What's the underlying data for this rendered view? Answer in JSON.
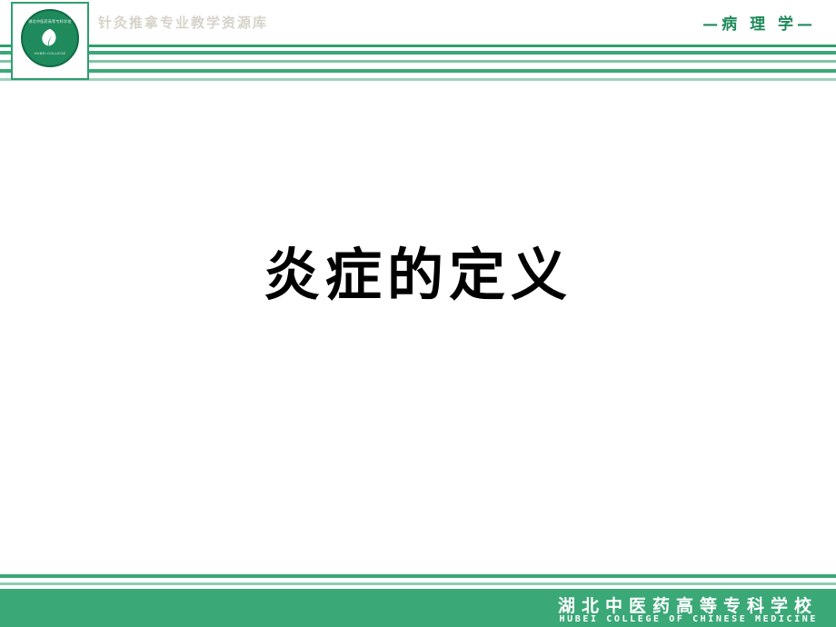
{
  "header": {
    "logo": {
      "icon": "leaf-emblem-icon",
      "ring_text": "湖北中医药高等专科学校",
      "bottom_text": "HUBEI COLLEGE"
    },
    "left_title": "针灸推拿专业教学资源库",
    "right_title": "—病 理 学—"
  },
  "main": {
    "title": "炎症的定义"
  },
  "footer": {
    "school_cn": "湖北中医药高等专科学校",
    "school_en": "HUBEI COLLEGE OF CHINESE MEDICINE"
  },
  "colors": {
    "brand_green": "#3aa877",
    "brand_green_dark": "#1f8a5c",
    "brand_green_light": "#9bd2ba",
    "title_text": "#000000",
    "header_left_text": "#d7d3cb",
    "footer_text": "#ffffff"
  }
}
